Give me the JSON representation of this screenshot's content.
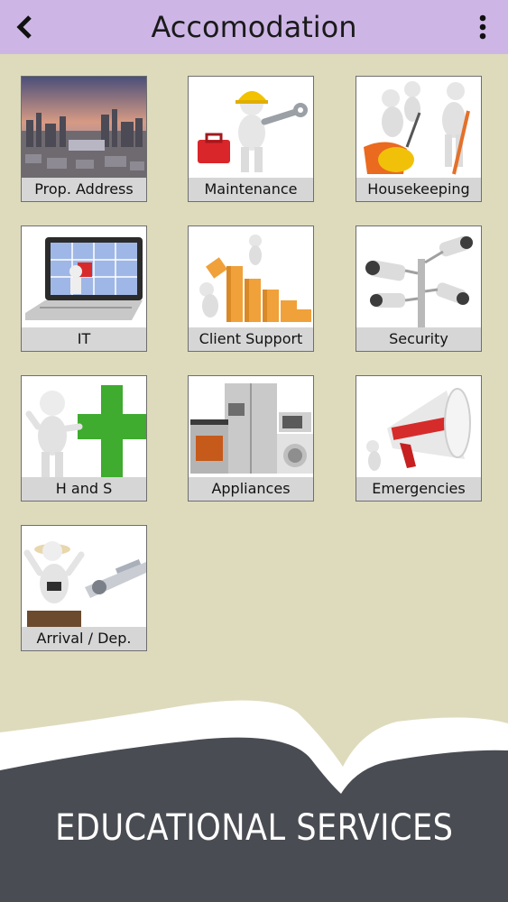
{
  "header": {
    "title": "Accomodation",
    "back_icon": "chevron-left-icon",
    "menu_icon": "more-vertical-icon",
    "background_color": "#cdb6e6"
  },
  "tiles": [
    {
      "label": "Prop. Address",
      "icon": "city-skyline-image"
    },
    {
      "label": "Maintenance",
      "icon": "worker-wrench-image"
    },
    {
      "label": "Housekeeping",
      "icon": "cleaning-crew-image"
    },
    {
      "label": "IT",
      "icon": "laptop-puzzle-image"
    },
    {
      "label": "Client Support",
      "icon": "climbing-steps-image"
    },
    {
      "label": "Security",
      "icon": "cctv-cameras-image"
    },
    {
      "label": "H and S",
      "icon": "health-cross-image"
    },
    {
      "label": "Appliances",
      "icon": "home-appliances-image"
    },
    {
      "label": "Emergencies",
      "icon": "megaphone-image"
    },
    {
      "label": "Arrival / Dep.",
      "icon": "traveler-airplane-image"
    }
  ],
  "footer": {
    "text": "EDUCATIONAL SERVICES",
    "background_color": "#494c52"
  },
  "page_background": "#dedbbd"
}
